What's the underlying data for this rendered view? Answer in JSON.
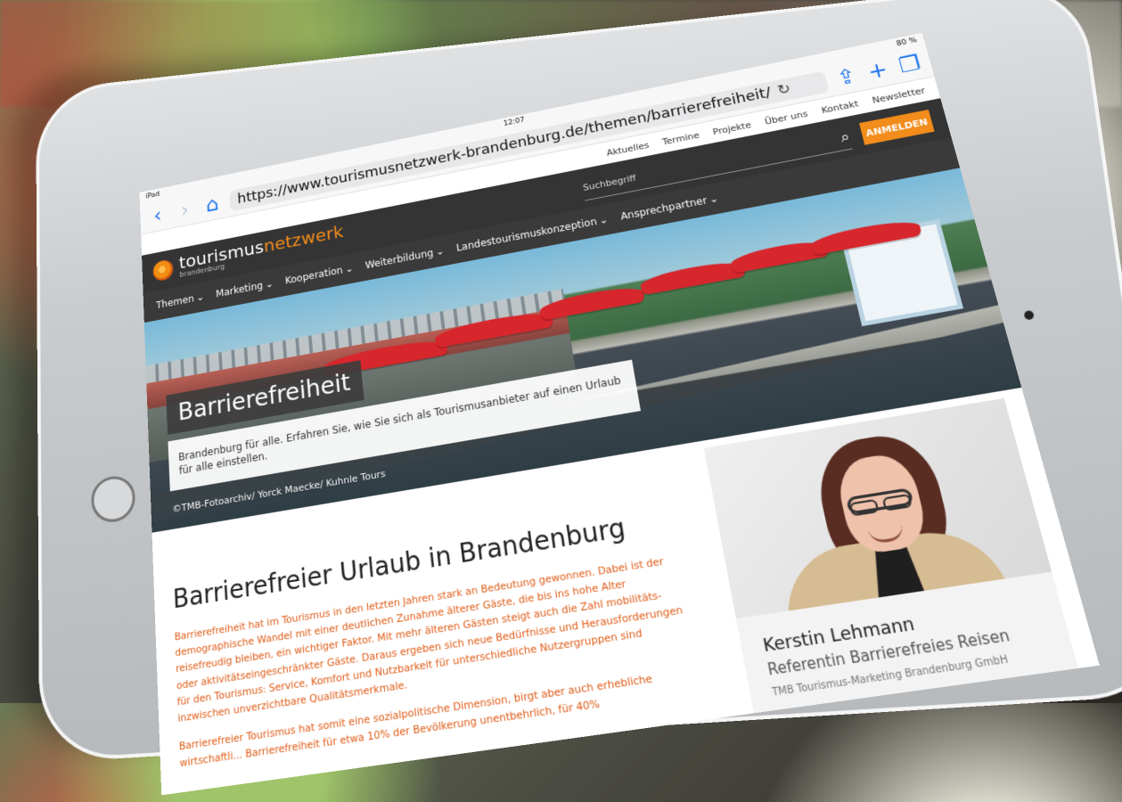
{
  "status": {
    "device": "iPad",
    "time": "12:07",
    "battery": "80 %"
  },
  "browser": {
    "url": "https://www.tourismusnetzwerk-brandenburg.de/themen/barrierefreiheit/"
  },
  "site": {
    "logo_main_left": "tourismus",
    "logo_main_right": "netzwerk",
    "logo_sub": "brandenburg",
    "search_placeholder": "Suchbegriff",
    "login_label": "ANMELDEN",
    "top_links": [
      "Aktuelles",
      "Termine",
      "Projekte",
      "Über uns",
      "Kontakt",
      "Newsletter"
    ],
    "nav_items": [
      "Themen",
      "Marketing",
      "Kooperation",
      "Weiterbildung",
      "Landestourismuskonzeption",
      "Ansprechpartner"
    ]
  },
  "hero": {
    "title": "Barrierefreiheit",
    "subtitle": "Brandenburg für alle. Erfahren Sie, wie Sie sich als Tourismusanbieter auf einen Urlaub für alle einstellen.",
    "credit": "©TMB-Fotoarchiv/ Yorck Maecke/ Kuhnle Tours"
  },
  "article": {
    "title": "Barrierefreier Urlaub in Brandenburg",
    "paragraph1": "Barrierefreiheit hat im Tourismus in den letzten Jahren stark an Bedeutung gewonnen. Dabei ist der demographische Wandel mit einer deutlichen Zunahme älterer Gäste, die bis ins hohe Alter reisefreudig bleiben, ein wichtiger Faktor. Mit mehr älteren Gästen steigt auch die Zahl mobilitäts- oder aktivitätseingeschränkter Gäste. Daraus ergeben sich neue Bedürfnisse und Herausforderungen für den Tourismus: Service, Komfort und Nutzbarkeit für unterschiedliche Nutzergruppen sind inzwischen unverzichtbare Qualitätsmerkmale.",
    "paragraph2": "Barrierefreier Tourismus hat somit eine sozialpolitische Dimension, birgt aber auch erhebliche wirtschaftli... Barrierefreiheit für etwa 10% der Bevölkerung unentbehrlich, für 40%"
  },
  "contact": {
    "name": "Kerstin Lehmann",
    "role": "Referentin Barrierefreies Reisen",
    "organization": "TMB Tourismus-Marketing Brandenburg GmbH"
  }
}
